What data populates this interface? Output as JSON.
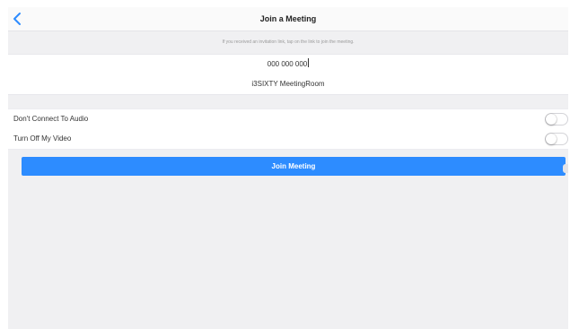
{
  "nav": {
    "title": "Join a Meeting",
    "back_icon": "chevron-left-icon"
  },
  "hint": "If you received an invitation link, tap on the link to join the meeting.",
  "form": {
    "meeting_id": "000 000 000",
    "display_name": "i3SIXTY MeetingRoom"
  },
  "options": [
    {
      "label": "Don't Connect To Audio",
      "checked": false
    },
    {
      "label": "Turn Off My Video",
      "checked": false
    }
  ],
  "join_button": {
    "label": "Join Meeting"
  },
  "colors": {
    "accent": "#2d8cff",
    "background": "#f0f0f2"
  }
}
